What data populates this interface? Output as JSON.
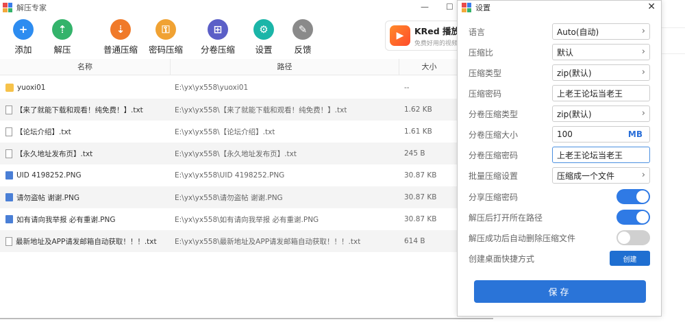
{
  "app": {
    "title": "解压专家"
  },
  "window_controls": {
    "minimize": "—",
    "maximize": "☐"
  },
  "toolbar": [
    {
      "label": "添加",
      "icon": "add-icon",
      "color": "#2d8cf0",
      "glyph": "+"
    },
    {
      "label": "解压",
      "icon": "unzip-icon",
      "color": "#34b36b",
      "glyph": "⇡"
    },
    {
      "label": "普通压缩",
      "icon": "compress-icon",
      "color": "#f07a2a",
      "glyph": "⇣"
    },
    {
      "label": "密码压缩",
      "icon": "password-compress-icon",
      "color": "#f0a233",
      "glyph": "⚿"
    },
    {
      "label": "分卷压缩",
      "icon": "split-compress-icon",
      "color": "#5b5fc7",
      "glyph": "⊞"
    },
    {
      "label": "设置",
      "icon": "gear-icon",
      "color": "#1bb5a8",
      "glyph": "⚙"
    },
    {
      "label": "反馈",
      "icon": "feedback-icon",
      "color": "#8a8a8a",
      "glyph": "✎"
    }
  ],
  "ad": {
    "title": "KRed 播放",
    "subtitle": "免费好用的视频"
  },
  "table": {
    "headers": {
      "name": "名称",
      "path": "路径",
      "size": "大小"
    },
    "rows": [
      {
        "type": "folder",
        "icon": "folder-icon",
        "name": "yuoxi01",
        "path": "E:\\yx\\yx558\\yuoxi01",
        "size": "--"
      },
      {
        "type": "txt",
        "icon": "text-file-icon",
        "name": "【来了就能下载和观看！纯免费！】.txt",
        "path": "E:\\yx\\yx558\\【来了就能下载和观看！纯免费！】.txt",
        "size": "1.62 KB"
      },
      {
        "type": "txt",
        "icon": "text-file-icon",
        "name": "【论坛介绍】.txt",
        "path": "E:\\yx\\yx558\\【论坛介绍】.txt",
        "size": "1.61 KB"
      },
      {
        "type": "txt",
        "icon": "text-file-icon",
        "name": "【永久地址发布页】.txt",
        "path": "E:\\yx\\yx558\\【永久地址发布页】.txt",
        "size": "245 B"
      },
      {
        "type": "img",
        "icon": "image-file-icon",
        "name": "UID 4198252.PNG",
        "path": "E:\\yx\\yx558\\UID 4198252.PNG",
        "size": "30.87 KB"
      },
      {
        "type": "img",
        "icon": "image-file-icon",
        "name": "请勿盗帖 谢谢.PNG",
        "path": "E:\\yx\\yx558\\请勿盗帖 谢谢.PNG",
        "size": "30.87 KB"
      },
      {
        "type": "img",
        "icon": "image-file-icon",
        "name": "如有请向我举报 必有重谢.PNG",
        "path": "E:\\yx\\yx558\\如有请向我举报 必有重谢.PNG",
        "size": "30.87 KB"
      },
      {
        "type": "txt",
        "icon": "text-file-icon",
        "name": "最新地址及APP请发邮箱自动获取！！！.txt",
        "path": "E:\\yx\\yx558\\最新地址及APP请发邮箱自动获取！！！.txt",
        "size": "614 B"
      }
    ]
  },
  "dialog": {
    "title": "设置",
    "close": "✕",
    "settings": {
      "language": {
        "label": "语言",
        "value": "Auto(自动)"
      },
      "ratio": {
        "label": "压缩比",
        "value": "默认"
      },
      "type": {
        "label": "压缩类型",
        "value": "zip(默认)"
      },
      "password": {
        "label": "压缩密码",
        "value": "上老王论坛当老王"
      },
      "split_type": {
        "label": "分卷压缩类型",
        "value": "zip(默认)"
      },
      "split_size": {
        "label": "分卷压缩大小",
        "value": "100",
        "unit": "MB"
      },
      "split_password": {
        "label": "分卷压缩密码",
        "value": "上老王论坛当老王"
      },
      "batch": {
        "label": "批量压缩设置",
        "value": "压缩成一个文件"
      },
      "share_password": {
        "label": "分享压缩密码",
        "enabled": true
      },
      "open_path": {
        "label": "解压后打开所在路径",
        "enabled": true
      },
      "auto_delete": {
        "label": "解压成功后自动删除压缩文件",
        "enabled": false
      },
      "shortcut": {
        "label": "创建桌面快捷方式",
        "button": "创建"
      }
    },
    "save": "保存"
  },
  "colors": {
    "accent": "#2a74d8",
    "toggle_on": "#2f7ae5",
    "toggle_off": "#d0d0d0"
  }
}
